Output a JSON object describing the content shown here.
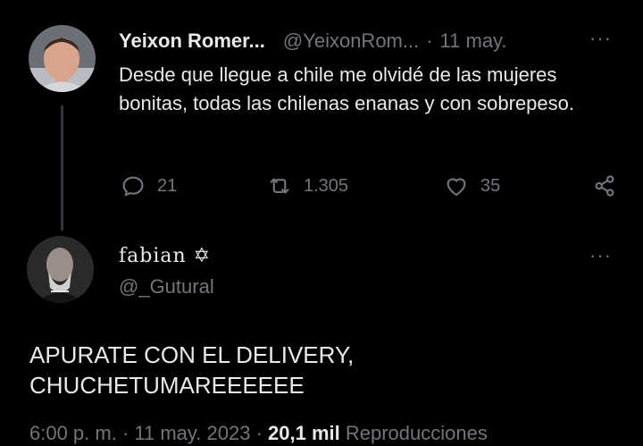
{
  "tweet1": {
    "display_name": "Yeixon Romer...",
    "handle": "@YeixonRom...",
    "separator": "·",
    "date": "11 may.",
    "more_label": "···",
    "text": "Desde que llegue a chile me olvidé de las mujeres bonitas, todas las chilenas enanas y con sobrepeso.",
    "actions": {
      "reply_icon": "reply-icon",
      "replies": "21",
      "retweet_icon": "retweet-icon",
      "retweets": "1.305",
      "like_icon": "heart-icon",
      "likes": "35",
      "share_icon": "share-icon"
    }
  },
  "tweet2": {
    "display_name": "fabian",
    "name_symbol": "✡",
    "handle": "@_Gutural",
    "more_label": "···",
    "text_line1": "APURATE CON EL DELIVERY,",
    "text_line2": "CHUCHETUMAREEEEEE",
    "time": "6:00 p. m.",
    "sep1": " · ",
    "date": "11 may. 2023",
    "sep2": " · ",
    "views": "20,1 mil",
    "views_label": " Reproducciones"
  },
  "colors": {
    "background": "#000000",
    "text": "#e7e9ea",
    "muted": "#71767b",
    "thread_line": "#333639"
  }
}
